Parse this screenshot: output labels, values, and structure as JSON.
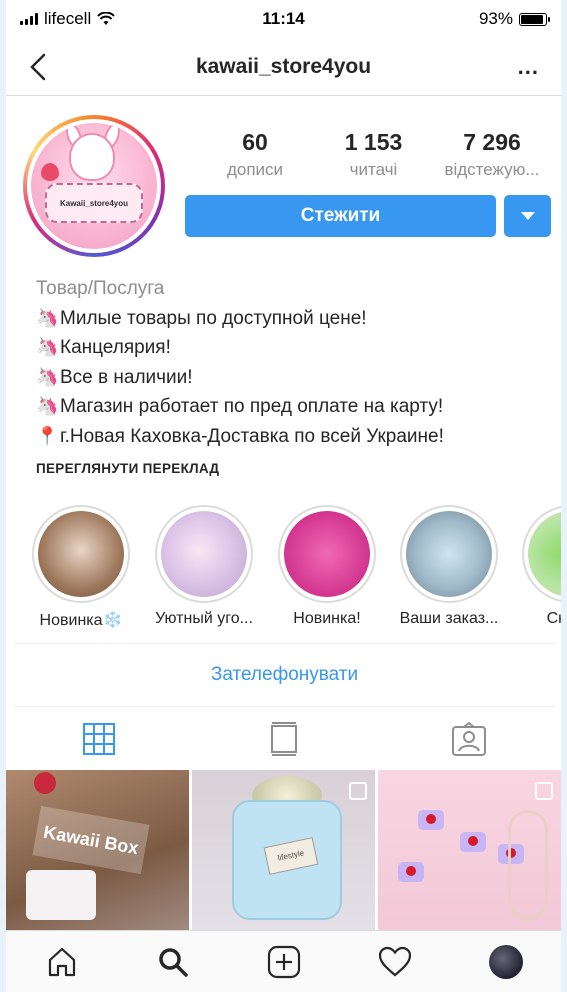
{
  "status_bar": {
    "carrier": "lifecell",
    "time": "11:14",
    "battery_percent": "93%",
    "battery_level": 0.93
  },
  "header": {
    "username": "kawaii_store4you",
    "back_icon": "chevron-left-icon",
    "more_label": "..."
  },
  "profile": {
    "avatar_text": "Kawaii_store4you",
    "stats": [
      {
        "value": "60",
        "label": "дописи"
      },
      {
        "value": "1 153",
        "label": "читачі"
      },
      {
        "value": "7 296",
        "label": "відстежую..."
      }
    ],
    "follow_label": "Стежити",
    "accent_color": "#3897f0"
  },
  "bio": {
    "category": "Товар/Послуга",
    "lines": [
      {
        "emoji": "🦄",
        "text": "Милые товары по доступной цене!"
      },
      {
        "emoji": "🦄",
        "text": "Канцелярия!"
      },
      {
        "emoji": "🦄",
        "text": "Все в наличии!"
      },
      {
        "emoji": "🦄",
        "text": "Магазин работает по пред оплате на карту!"
      },
      {
        "emoji": "📍",
        "text": "г.Новая Каховка-Доставка по всей Украине!"
      }
    ],
    "see_translation": "ПЕРЕГЛЯНУТИ ПЕРЕКЛАД"
  },
  "highlights": [
    {
      "label": "Новинка❄️"
    },
    {
      "label": "Уютный уго..."
    },
    {
      "label": "Новинка!"
    },
    {
      "label": "Ваши заказ..."
    },
    {
      "label": "Сквиш"
    }
  ],
  "call_button": "Зателефонувати",
  "tabs": [
    {
      "icon": "grid-icon",
      "active": true
    },
    {
      "icon": "feed-icon",
      "active": false
    },
    {
      "icon": "tagged-icon",
      "active": false
    }
  ],
  "posts": [
    {
      "caption": "Kawaii Box"
    },
    {
      "caption": "lifestyle"
    },
    {
      "caption": ""
    }
  ],
  "bottom_nav": [
    "home-icon",
    "search-icon",
    "add-icon",
    "heart-icon",
    "profile-icon"
  ]
}
